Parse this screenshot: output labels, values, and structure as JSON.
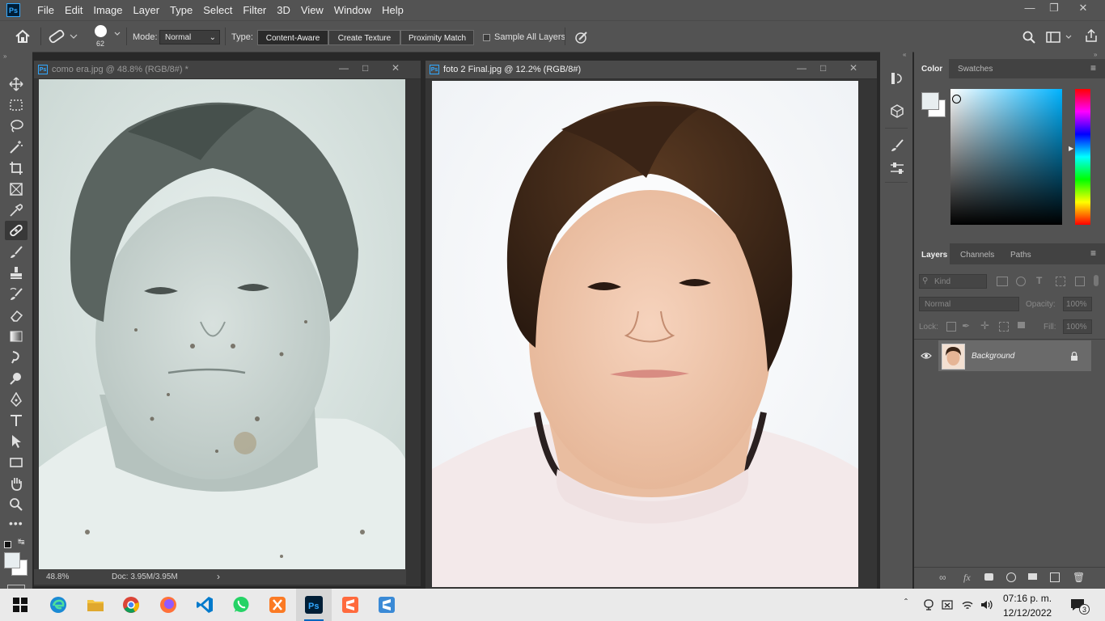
{
  "app": {
    "logo": "Ps",
    "menus": [
      "File",
      "Edit",
      "Image",
      "Layer",
      "Type",
      "Select",
      "Filter",
      "3D",
      "View",
      "Window",
      "Help"
    ],
    "window_controls": [
      "minimize-icon",
      "restore-icon",
      "close-icon"
    ]
  },
  "options_bar": {
    "brush_size": "62",
    "mode_label": "Mode:",
    "mode_value": "Normal",
    "type_label": "Type:",
    "type_buttons": [
      "Content-Aware",
      "Create Texture",
      "Proximity Match"
    ],
    "active_type": "Content-Aware",
    "sample_all_layers": "Sample All Layers",
    "sample_all_checked": false
  },
  "documents": [
    {
      "title": "como era.jpg @ 48.8% (RGB/8#) *",
      "zoom": "48.8%",
      "doc_size": "Doc: 3.95M/3.95M",
      "active": false
    },
    {
      "title": "foto 2 Final.jpg @ 12.2% (RGB/8#)",
      "active": true
    }
  ],
  "color_panel": {
    "tabs": [
      "Color",
      "Swatches"
    ],
    "active_tab": "Color",
    "foreground": "#e8eef0",
    "background": "#ffffff",
    "hue_color": "#00b3ff"
  },
  "layers_panel": {
    "tabs": [
      "Layers",
      "Channels",
      "Paths"
    ],
    "active_tab": "Layers",
    "kind_placeholder": "Kind",
    "blend_mode": "Normal",
    "opacity_label": "Opacity:",
    "opacity_value": "100%",
    "lock_label": "Lock:",
    "fill_label": "Fill:",
    "fill_value": "100%",
    "layers": [
      {
        "name": "Background",
        "visible": true,
        "locked": true
      }
    ]
  },
  "taskbar": {
    "time": "07:16 p. m.",
    "date": "12/12/2022",
    "notifications": "3",
    "apps": [
      "windows-start-icon",
      "edge-icon",
      "file-explorer-icon",
      "chrome-icon",
      "firefox-icon",
      "vscode-icon",
      "whatsapp-icon",
      "xampp-icon",
      "photoshop-icon",
      "sublime-icon",
      "sublime-merge-icon"
    ]
  }
}
